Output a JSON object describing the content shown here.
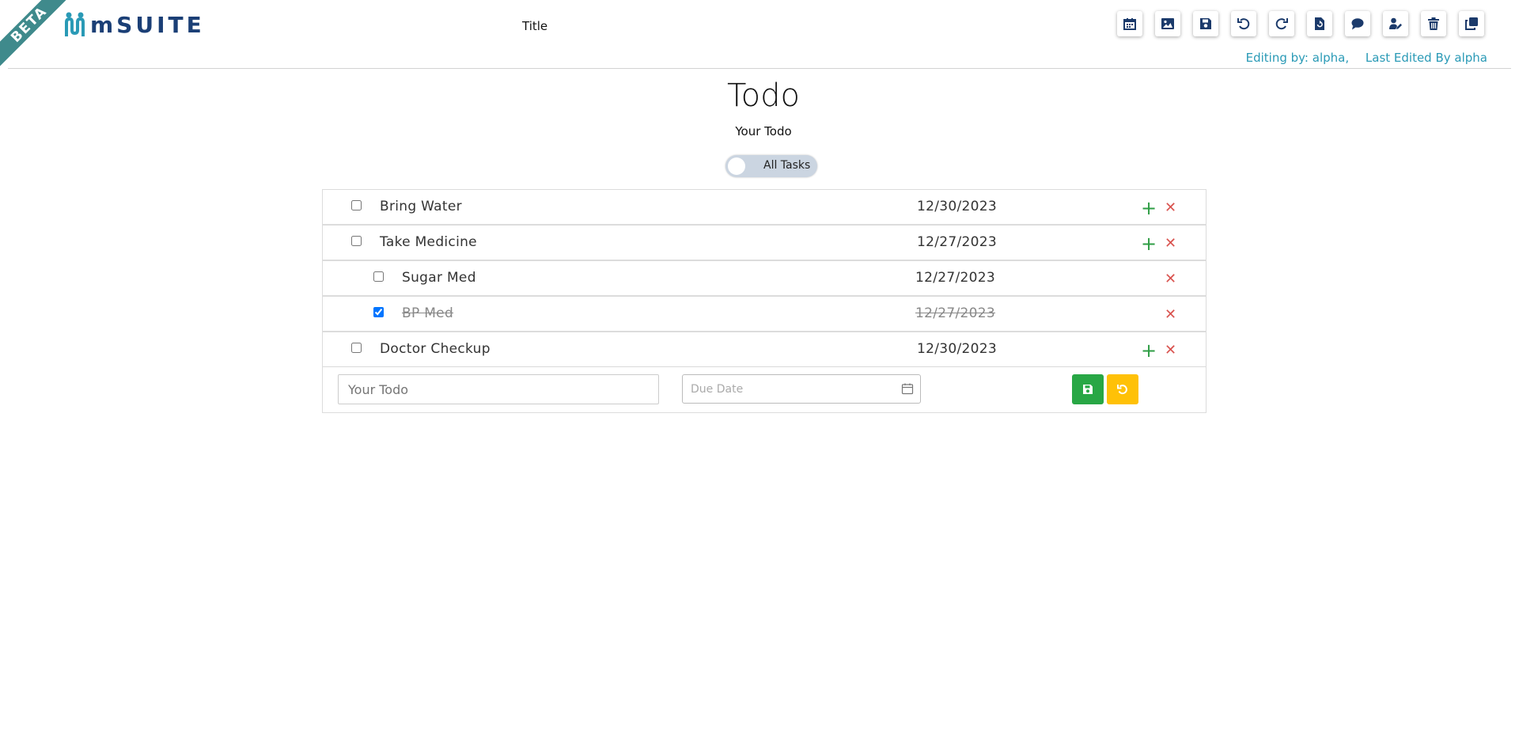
{
  "app": {
    "logo_text": "mSUITE",
    "beta_label": "BETA",
    "doc_title": "Title"
  },
  "toolbar": {
    "buttons": [
      {
        "name": "calendar-icon"
      },
      {
        "name": "image-icon"
      },
      {
        "name": "save-icon"
      },
      {
        "name": "undo-icon"
      },
      {
        "name": "redo-icon"
      },
      {
        "name": "file-restore-icon"
      },
      {
        "name": "comment-icon"
      },
      {
        "name": "user-edit-icon"
      },
      {
        "name": "trash-icon"
      },
      {
        "name": "copy-icon"
      }
    ]
  },
  "edit_info": {
    "editing_by": "Editing by: alpha,",
    "last_edited": "Last Edited By alpha"
  },
  "page": {
    "heading": "Todo",
    "subheading": "Your Todo",
    "toggle_label": "All Tasks"
  },
  "todos": [
    {
      "task": "Bring Water",
      "date": "12/30/2023",
      "level": 0,
      "done": false
    },
    {
      "task": "Take Medicine",
      "date": "12/27/2023",
      "level": 0,
      "done": false
    },
    {
      "task": "Sugar Med",
      "date": "12/27/2023",
      "level": 1,
      "done": false
    },
    {
      "task": "BP Med",
      "date": "12/27/2023",
      "level": 1,
      "done": true
    },
    {
      "task": "Doctor Checkup",
      "date": "12/30/2023",
      "level": 0,
      "done": false
    }
  ],
  "entry": {
    "todo_placeholder": "Your Todo",
    "date_placeholder": "Due Date"
  },
  "colors": {
    "accent": "#1b3f76",
    "success": "#28a745",
    "warning": "#ffc107",
    "danger": "#d9534f",
    "info": "#2a9ab6"
  }
}
